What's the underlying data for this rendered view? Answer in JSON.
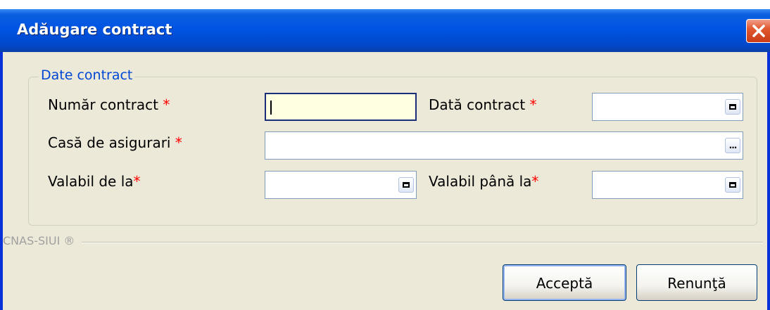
{
  "window": {
    "title": "Adăugare contract"
  },
  "group": {
    "legend": "Date contract"
  },
  "fields": {
    "numar_contract": {
      "label": "Număr contract",
      "required": "*",
      "value": ""
    },
    "data_contract": {
      "label": "Dată contract",
      "required": "*",
      "value": ""
    },
    "casa_asigurari": {
      "label": "Casă de asigurari",
      "required": "*",
      "value": ""
    },
    "valabil_de_la": {
      "label": "Valabil de la",
      "required": "*",
      "value": ""
    },
    "valabil_pana_la": {
      "label": "Valabil până la",
      "required": "*",
      "value": ""
    }
  },
  "browse_button_label": "...",
  "footer": {
    "label": "CNAS-SIUI ®"
  },
  "buttons": {
    "accept": "Acceptă",
    "cancel": "Renunţă"
  },
  "colors": {
    "title_bar": "#0054e3",
    "required_marker": "#ff0000",
    "focused_field_bg": "#ffffe1",
    "legend_text": "#0046d5"
  },
  "icons": {
    "close": "close-icon",
    "calendar": "calendar-icon",
    "browse": "ellipsis-icon"
  }
}
